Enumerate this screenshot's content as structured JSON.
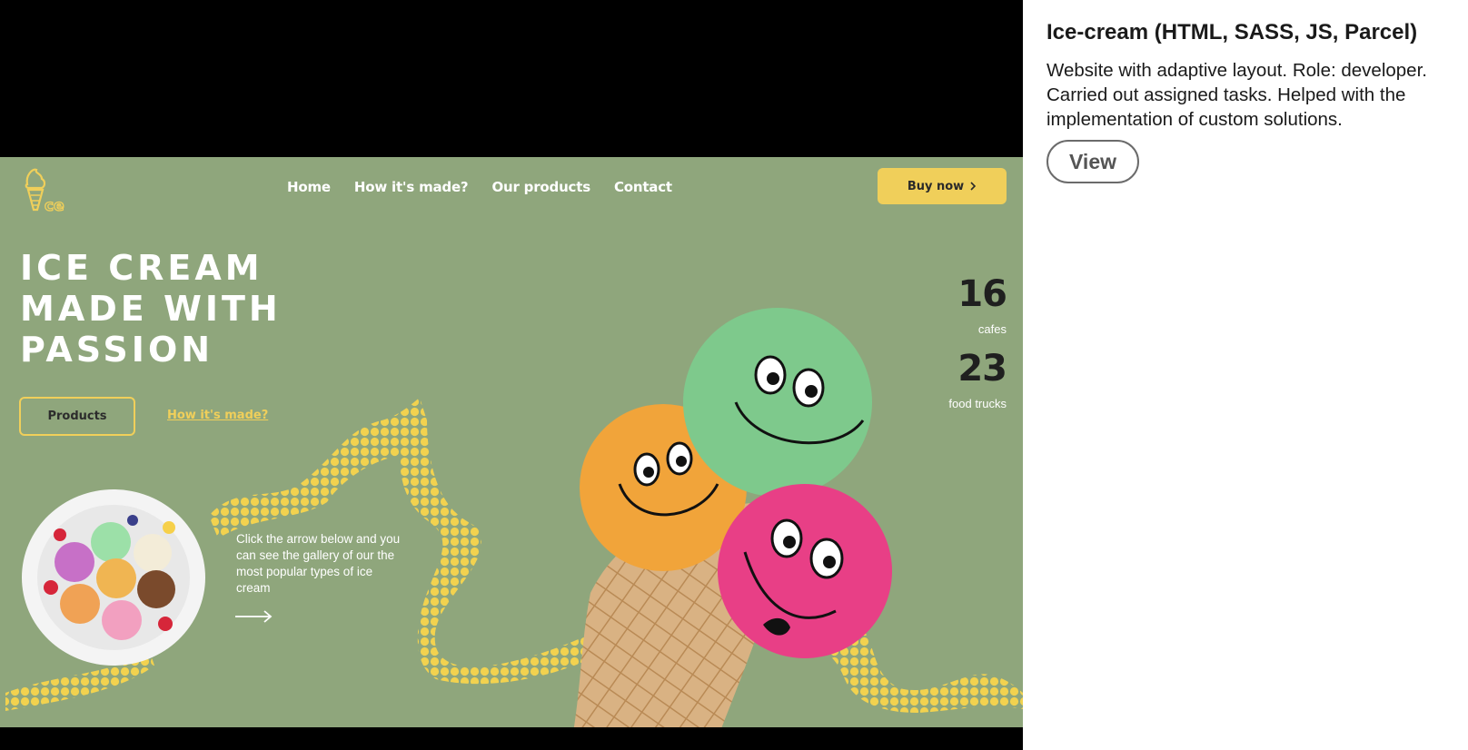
{
  "site": {
    "logo_text": "ce",
    "nav": [
      "Home",
      "How it's made?",
      "Our products",
      "Contact"
    ],
    "buy_button": "Buy now",
    "hero_title": "ICE CREAM\nMADE WITH\nPASSION",
    "products_button": "Products",
    "how_link": "How it's made?",
    "stats": [
      {
        "number": "16",
        "label": "cafes"
      },
      {
        "number": "23",
        "label": "food trucks"
      }
    ],
    "gallery_text": "Click the arrow below and you can see the gallery of our the most popular types of ice cream",
    "colors": {
      "background": "#8fa67c",
      "accent": "#f0cf5a"
    },
    "icons": [
      "ice-cream-logo-icon",
      "chevron-right-icon",
      "arrow-right-icon"
    ]
  },
  "card": {
    "title": "Ice-cream (HTML, SASS, JS, Parcel)",
    "description": "Website with adaptive layout. Role: developer. Carried out assigned tasks. Helped with the implementation of custom solutions.",
    "view_button": "View"
  }
}
